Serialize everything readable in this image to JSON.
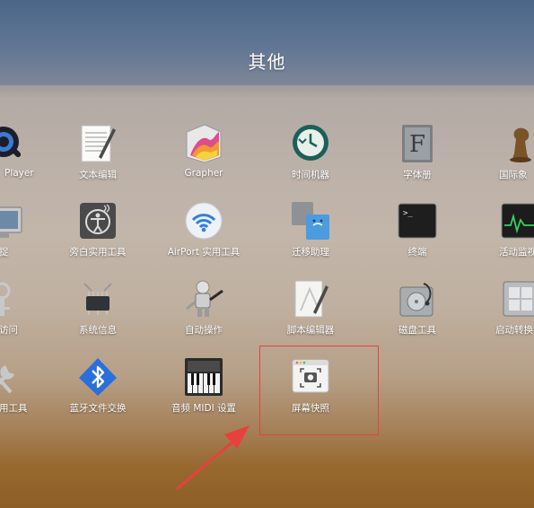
{
  "folder": {
    "title": "其他"
  },
  "apps": [
    {
      "label": "Player",
      "icon": "quicktime-player-icon"
    },
    {
      "label": "文本编辑",
      "icon": "textedit-icon"
    },
    {
      "label": "Grapher",
      "icon": "grapher-icon"
    },
    {
      "label": "时间机器",
      "icon": "time-machine-icon"
    },
    {
      "label": "字体册",
      "icon": "font-book-icon"
    },
    {
      "label": "国际象",
      "icon": "chess-icon"
    },
    {
      "label": "捉",
      "icon": "screenshot-icon"
    },
    {
      "label": "旁白实用工具",
      "icon": "voiceover-utility-icon"
    },
    {
      "label": "AirPort 实用工具",
      "icon": "airport-utility-icon"
    },
    {
      "label": "迁移助理",
      "icon": "migration-assistant-icon"
    },
    {
      "label": "终端",
      "icon": "terminal-icon"
    },
    {
      "label": "活动监视",
      "icon": "activity-monitor-icon"
    },
    {
      "label": "访问",
      "icon": "keychain-access-icon"
    },
    {
      "label": "系统信息",
      "icon": "system-information-icon"
    },
    {
      "label": "自动操作",
      "icon": "automator-icon"
    },
    {
      "label": "脚本编辑器",
      "icon": "script-editor-icon"
    },
    {
      "label": "磁盘工具",
      "icon": "disk-utility-icon"
    },
    {
      "label": "启动转换",
      "icon": "boot-camp-icon"
    },
    {
      "label": "用工具",
      "icon": "utility-tools-icon"
    },
    {
      "label": "蓝牙文件交换",
      "icon": "bluetooth-file-exchange-icon"
    },
    {
      "label": "音频 MIDI 设置",
      "icon": "audio-midi-setup-icon"
    },
    {
      "label": "屏幕快照",
      "icon": "screenshot-camera-icon"
    }
  ],
  "colors": {
    "highlight": "#e8403d",
    "arrow": "#e8403d",
    "label": "#ffffff"
  }
}
